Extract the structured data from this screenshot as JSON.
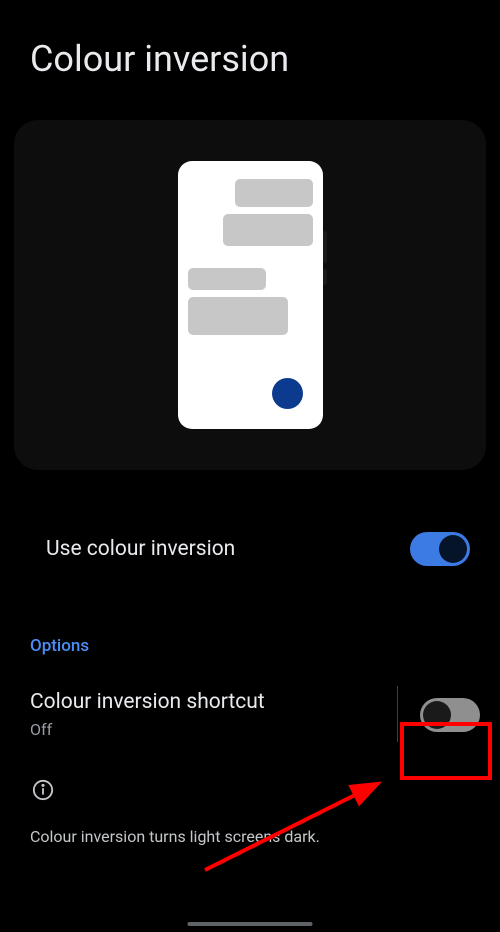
{
  "header": {
    "title": "Colour inversion"
  },
  "settings": {
    "useColourInversion": {
      "label": "Use colour inversion",
      "enabled": true
    }
  },
  "sections": {
    "optionsHeader": "Options"
  },
  "shortcut": {
    "title": "Colour inversion shortcut",
    "status": "Off",
    "enabled": false
  },
  "footer": {
    "description": "Colour inversion turns light screens dark."
  },
  "annotation": {
    "highlightColor": "#ff0000"
  }
}
